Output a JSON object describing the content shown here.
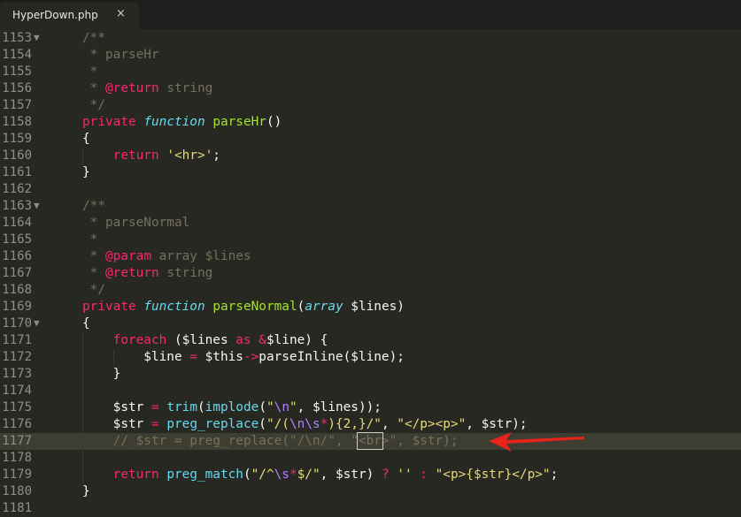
{
  "tab": {
    "title": "HyperDown.php",
    "close_icon": "×"
  },
  "highlight_line": "1177",
  "colors": {
    "background": "#272822",
    "comment": "#75715e",
    "keyword": "#f92672",
    "function": "#a6e22e",
    "string": "#e6db74",
    "arrow": "#e8231a"
  },
  "lines": [
    {
      "n": "1153",
      "fold": true,
      "guides": 0,
      "tokens": [
        {
          "t": "/**",
          "c": "cm"
        }
      ]
    },
    {
      "n": "1154",
      "guides": 0,
      "tokens": [
        {
          "t": " * parseHr",
          "c": "cm"
        }
      ]
    },
    {
      "n": "1155",
      "guides": 0,
      "tokens": [
        {
          "t": " *",
          "c": "cm"
        }
      ]
    },
    {
      "n": "1156",
      "guides": 0,
      "tokens": [
        {
          "t": " * ",
          "c": "cm"
        },
        {
          "t": "@return",
          "c": "kw"
        },
        {
          "t": " string",
          "c": "cm"
        }
      ]
    },
    {
      "n": "1157",
      "guides": 0,
      "tokens": [
        {
          "t": " */",
          "c": "cm"
        }
      ]
    },
    {
      "n": "1158",
      "guides": 0,
      "tokens": [
        {
          "t": "private",
          "c": "kw"
        },
        {
          "t": " ",
          "c": "pl"
        },
        {
          "t": "function",
          "c": "st"
        },
        {
          "t": " ",
          "c": "pl"
        },
        {
          "t": "parseHr",
          "c": "fn"
        },
        {
          "t": "()",
          "c": "pl"
        }
      ]
    },
    {
      "n": "1159",
      "guides": 0,
      "tokens": [
        {
          "t": "{",
          "c": "pl"
        }
      ]
    },
    {
      "n": "1160",
      "guides": 1,
      "tokens": [
        {
          "t": "    ",
          "c": "pl"
        },
        {
          "t": "return",
          "c": "kw"
        },
        {
          "t": " ",
          "c": "pl"
        },
        {
          "t": "'<hr>'",
          "c": "str"
        },
        {
          "t": ";",
          "c": "pl"
        }
      ]
    },
    {
      "n": "1161",
      "guides": 0,
      "tokens": [
        {
          "t": "}",
          "c": "pl"
        }
      ]
    },
    {
      "n": "1162",
      "guides": 0,
      "tokens": []
    },
    {
      "n": "1163",
      "fold": true,
      "guides": 0,
      "tokens": [
        {
          "t": "/**",
          "c": "cm"
        }
      ]
    },
    {
      "n": "1164",
      "guides": 0,
      "tokens": [
        {
          "t": " * parseNormal",
          "c": "cm"
        }
      ]
    },
    {
      "n": "1165",
      "guides": 0,
      "tokens": [
        {
          "t": " *",
          "c": "cm"
        }
      ]
    },
    {
      "n": "1166",
      "guides": 0,
      "tokens": [
        {
          "t": " * ",
          "c": "cm"
        },
        {
          "t": "@param",
          "c": "kw"
        },
        {
          "t": " array $lines",
          "c": "cm"
        }
      ]
    },
    {
      "n": "1167",
      "guides": 0,
      "tokens": [
        {
          "t": " * ",
          "c": "cm"
        },
        {
          "t": "@return",
          "c": "kw"
        },
        {
          "t": " string",
          "c": "cm"
        }
      ]
    },
    {
      "n": "1168",
      "guides": 0,
      "tokens": [
        {
          "t": " */",
          "c": "cm"
        }
      ]
    },
    {
      "n": "1169",
      "guides": 0,
      "tokens": [
        {
          "t": "private",
          "c": "kw"
        },
        {
          "t": " ",
          "c": "pl"
        },
        {
          "t": "function",
          "c": "st"
        },
        {
          "t": " ",
          "c": "pl"
        },
        {
          "t": "parseNormal",
          "c": "fn"
        },
        {
          "t": "(",
          "c": "pl"
        },
        {
          "t": "array",
          "c": "st"
        },
        {
          "t": " $lines)",
          "c": "pl"
        }
      ]
    },
    {
      "n": "1170",
      "fold": true,
      "guides": 0,
      "tokens": [
        {
          "t": "{",
          "c": "pl"
        }
      ]
    },
    {
      "n": "1171",
      "guides": 1,
      "tokens": [
        {
          "t": "    ",
          "c": "pl"
        },
        {
          "t": "foreach",
          "c": "kw"
        },
        {
          "t": " ($lines ",
          "c": "pl"
        },
        {
          "t": "as",
          "c": "kw"
        },
        {
          "t": " ",
          "c": "pl"
        },
        {
          "t": "&",
          "c": "kw"
        },
        {
          "t": "$line) {",
          "c": "pl"
        }
      ]
    },
    {
      "n": "1172",
      "guides": 2,
      "tokens": [
        {
          "t": "        $line ",
          "c": "pl"
        },
        {
          "t": "=",
          "c": "kw"
        },
        {
          "t": " $this",
          "c": "pl"
        },
        {
          "t": "->",
          "c": "kw"
        },
        {
          "t": "parseInline($line);",
          "c": "pl"
        }
      ]
    },
    {
      "n": "1173",
      "guides": 1,
      "tokens": [
        {
          "t": "    }",
          "c": "pl"
        }
      ]
    },
    {
      "n": "1174",
      "guides": 1,
      "tokens": []
    },
    {
      "n": "1175",
      "guides": 1,
      "tokens": [
        {
          "t": "    $str ",
          "c": "pl"
        },
        {
          "t": "=",
          "c": "kw"
        },
        {
          "t": " ",
          "c": "pl"
        },
        {
          "t": "trim",
          "c": "bi"
        },
        {
          "t": "(",
          "c": "pl"
        },
        {
          "t": "implode",
          "c": "bi"
        },
        {
          "t": "(",
          "c": "pl"
        },
        {
          "t": "\"",
          "c": "str"
        },
        {
          "t": "\\n",
          "c": "esc"
        },
        {
          "t": "\"",
          "c": "str"
        },
        {
          "t": ", $lines));",
          "c": "pl"
        }
      ]
    },
    {
      "n": "1176",
      "guides": 1,
      "tokens": [
        {
          "t": "    $str ",
          "c": "pl"
        },
        {
          "t": "=",
          "c": "kw"
        },
        {
          "t": " ",
          "c": "pl"
        },
        {
          "t": "preg_replace",
          "c": "bi"
        },
        {
          "t": "(",
          "c": "pl"
        },
        {
          "t": "\"/(",
          "c": "str"
        },
        {
          "t": "\\n\\s",
          "c": "esc"
        },
        {
          "t": "*",
          "c": "kw"
        },
        {
          "t": "){2,}/\"",
          "c": "str"
        },
        {
          "t": ", ",
          "c": "pl"
        },
        {
          "t": "\"</p><p>\"",
          "c": "str"
        },
        {
          "t": ", $str);",
          "c": "pl"
        }
      ]
    },
    {
      "n": "1177",
      "guides": 1,
      "tokens": [
        {
          "t": "    // $str = preg_replace(\"/\\n/\", \"",
          "c": "cm"
        },
        {
          "t": "<br",
          "c": "cm",
          "box": true
        },
        {
          "t": ">\", $str);",
          "c": "cm"
        }
      ]
    },
    {
      "n": "1178",
      "guides": 1,
      "tokens": []
    },
    {
      "n": "1179",
      "guides": 1,
      "tokens": [
        {
          "t": "    ",
          "c": "pl"
        },
        {
          "t": "return",
          "c": "kw"
        },
        {
          "t": " ",
          "c": "pl"
        },
        {
          "t": "preg_match",
          "c": "bi"
        },
        {
          "t": "(",
          "c": "pl"
        },
        {
          "t": "\"/^",
          "c": "str"
        },
        {
          "t": "\\s",
          "c": "esc"
        },
        {
          "t": "*",
          "c": "kw"
        },
        {
          "t": "$/\"",
          "c": "str"
        },
        {
          "t": ", $str) ",
          "c": "pl"
        },
        {
          "t": "?",
          "c": "kw"
        },
        {
          "t": " ",
          "c": "pl"
        },
        {
          "t": "''",
          "c": "str"
        },
        {
          "t": " ",
          "c": "pl"
        },
        {
          "t": ":",
          "c": "kw"
        },
        {
          "t": " ",
          "c": "pl"
        },
        {
          "t": "\"<p>{$str}</p>\"",
          "c": "str"
        },
        {
          "t": ";",
          "c": "pl"
        }
      ]
    },
    {
      "n": "1180",
      "guides": 0,
      "tokens": [
        {
          "t": "}",
          "c": "pl"
        }
      ]
    },
    {
      "n": "1181",
      "guides": 0,
      "tokens": []
    }
  ]
}
